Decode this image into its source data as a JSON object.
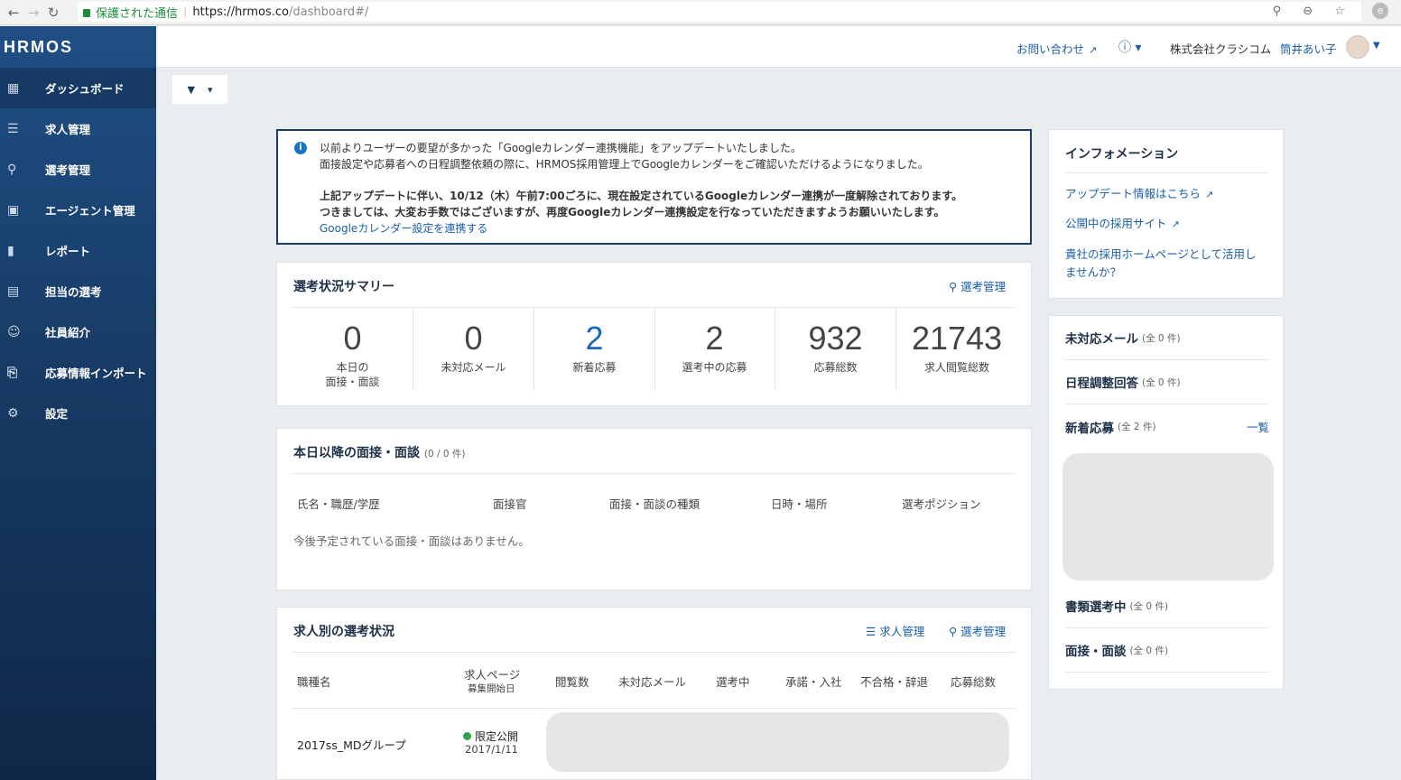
{
  "browser": {
    "secure_label": "保護された通信",
    "url_host": "https://hrmos.co",
    "url_path": "/dashboard#/"
  },
  "sidebar": {
    "logo": "HRMOS",
    "items": [
      {
        "label": "ダッシュボード",
        "icon": "dashboard-icon"
      },
      {
        "label": "求人管理",
        "icon": "job-icon"
      },
      {
        "label": "選考管理",
        "icon": "search-icon"
      },
      {
        "label": "エージェント管理",
        "icon": "agent-icon"
      },
      {
        "label": "レポート",
        "icon": "chart-icon"
      },
      {
        "label": "担当の選考",
        "icon": "assigned-icon"
      },
      {
        "label": "社員紹介",
        "icon": "people-icon"
      },
      {
        "label": "応募情報インポート",
        "icon": "import-icon"
      },
      {
        "label": "設定",
        "icon": "gear-icon"
      }
    ]
  },
  "header": {
    "contact": "お問い合わせ",
    "company": "株式会社クラシコム",
    "user": "筒井あい子"
  },
  "notice": {
    "line1": "以前よりユーザーの要望が多かった「Googleカレンダー連携機能」をアップデートいたしました。",
    "line2": "面接設定や応募者への日程調整依頼の際に、HRMOS採用管理上でGoogleカレンダーをご確認いただけるようになりました。",
    "line3": "上記アップデートに伴い、10/12（木）午前7:00ごろに、現在設定されているGoogleカレンダー連携が一度解除されております。",
    "line4": "つきましては、大変お手数ではございますが、再度Googleカレンダー連携設定を行なっていただきますようお願いいたします。",
    "link": "Googleカレンダー設定を連携する"
  },
  "summary": {
    "title": "選考状況サマリー",
    "link": "選考管理",
    "stats": [
      {
        "value": "0",
        "label1": "本日の",
        "label2": "面接・面談"
      },
      {
        "value": "0",
        "label1": "未対応メール",
        "label2": ""
      },
      {
        "value": "2",
        "label1": "新着応募",
        "label2": ""
      },
      {
        "value": "2",
        "label1": "選考中の応募",
        "label2": ""
      },
      {
        "value": "932",
        "label1": "応募総数",
        "label2": ""
      },
      {
        "value": "21743",
        "label1": "求人閲覧総数",
        "label2": ""
      }
    ]
  },
  "interviews": {
    "title": "本日以降の面接・面談",
    "count": "(0 / 0 件)",
    "columns": [
      "氏名・職歴/学歴",
      "面接官",
      "面接・面談の種類",
      "日時・場所",
      "選考ポジション"
    ],
    "empty": "今後予定されている面接・面談はありません。"
  },
  "jobs": {
    "title": "求人別の選考状況",
    "link_jobs": "求人管理",
    "link_selection": "選考管理",
    "columns": {
      "job_name": "職種名",
      "job_page": "求人ページ",
      "start_date_label": "募集開始日",
      "views": "閲覧数",
      "unhandled": "未対応メール",
      "in_progress": "選考中",
      "accepted": "承諾・入社",
      "rejected": "不合格・辞退",
      "total": "応募総数"
    },
    "rows": [
      {
        "name": "2017ss_MDグループ",
        "status": "限定公開",
        "date": "2017/1/11"
      }
    ]
  },
  "info": {
    "title": "インフォメーション",
    "link1": "アップデート情報はこちら",
    "link2": "公開中の採用サイト",
    "link3a": "貴社の採用ホームページとして活用し",
    "link3b": "ませんか？"
  },
  "status_list": [
    {
      "title": "未対応メール",
      "count": "(全 0 件)"
    },
    {
      "title": "日程調整回答",
      "count": "(全 0 件)"
    },
    {
      "title": "新着応募",
      "count": "(全 2 件)",
      "link": "一覧"
    },
    {
      "title": "書類選考中",
      "count": "(全 0 件)"
    },
    {
      "title": "面接・面談",
      "count": "(全 0 件)"
    }
  ]
}
